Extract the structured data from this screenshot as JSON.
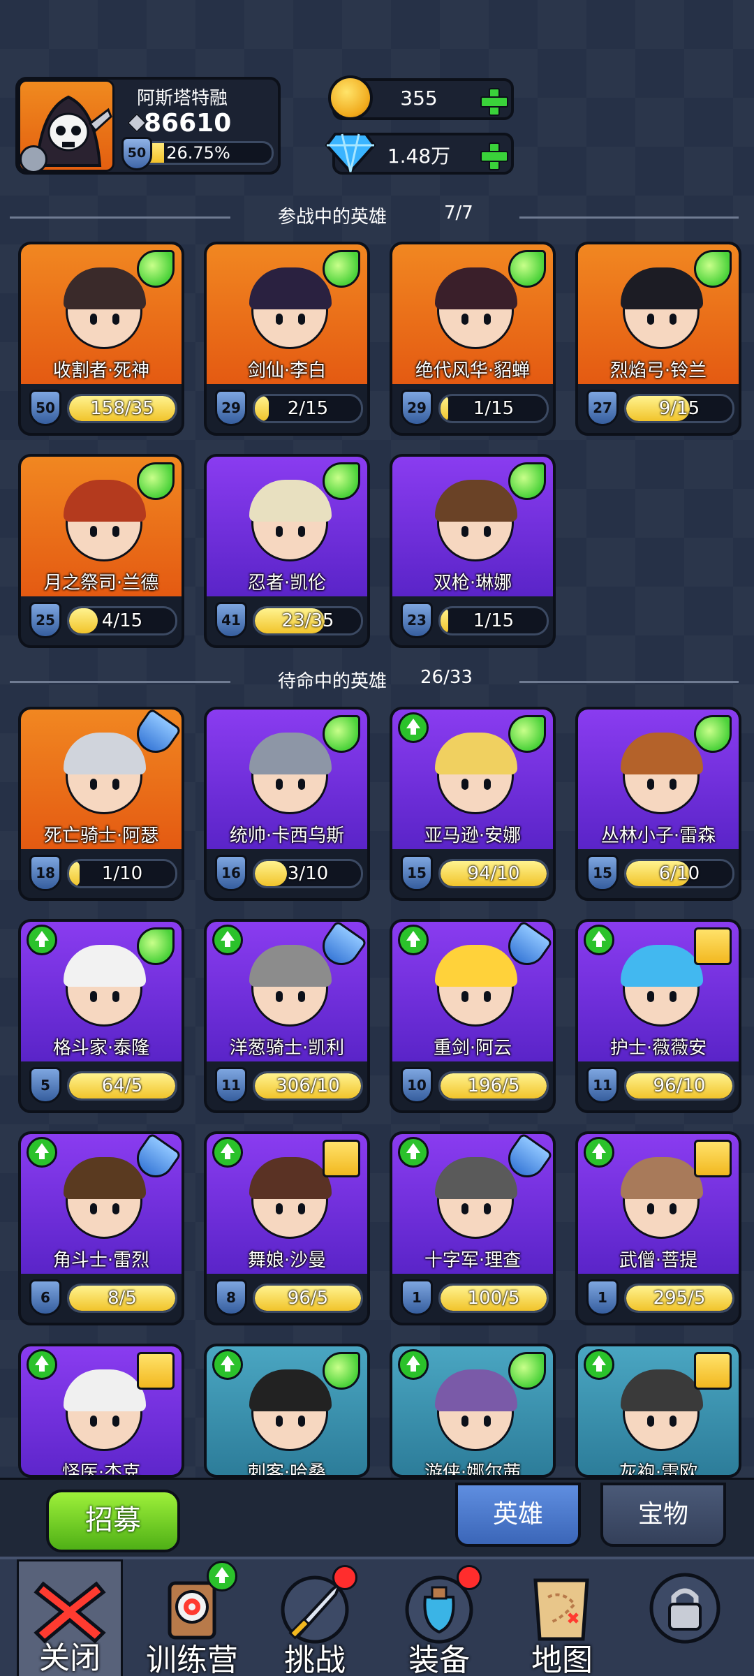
{
  "profile": {
    "name": "阿斯塔特融",
    "power": "86610",
    "level": "50",
    "exp_pct": "26.75%",
    "exp_fraction": 0.2675
  },
  "currency": {
    "gold": "355",
    "gems": "1.48万"
  },
  "active_section": {
    "title": "参战中的英雄",
    "count": "7/7"
  },
  "standby_section": {
    "title": "待命中的英雄",
    "count": "26/33"
  },
  "active_heroes": [
    {
      "name": "收割者·死神",
      "level": "50",
      "progress": "158/35",
      "fill": 1.0,
      "bg": "orange",
      "badge": "wing-icon",
      "upgrade": false,
      "hair": "#3a2a2a"
    },
    {
      "name": "剑仙·李白",
      "level": "29",
      "progress": "2/15",
      "fill": 0.13,
      "bg": "orange",
      "badge": "wing-icon",
      "upgrade": false,
      "hair": "#2a2140"
    },
    {
      "name": "绝代风华·貂蝉",
      "level": "29",
      "progress": "1/15",
      "fill": 0.07,
      "bg": "orange",
      "badge": "wing-icon",
      "upgrade": false,
      "hair": "#3a1f2a"
    },
    {
      "name": "烈焰弓·铃兰",
      "level": "27",
      "progress": "9/15",
      "fill": 0.6,
      "bg": "orange",
      "badge": "wing-icon",
      "upgrade": false,
      "hair": "#1c1c24"
    },
    {
      "name": "月之祭司·兰德",
      "level": "25",
      "progress": "4/15",
      "fill": 0.27,
      "bg": "orange",
      "badge": "wing-icon",
      "upgrade": false,
      "hair": "#b43a1e"
    },
    {
      "name": "忍者·凯伦",
      "level": "41",
      "progress": "23/35",
      "fill": 0.66,
      "bg": "purple",
      "badge": "wing-icon",
      "upgrade": false,
      "hair": "#e8e0c0"
    },
    {
      "name": "双枪·琳娜",
      "level": "23",
      "progress": "1/15",
      "fill": 0.07,
      "bg": "purple",
      "badge": "wing-icon",
      "upgrade": false,
      "hair": "#6a4226"
    }
  ],
  "standby_heroes": [
    {
      "name": "死亡骑士·阿瑟",
      "level": "18",
      "progress": "1/10",
      "fill": 0.1,
      "bg": "orange",
      "badge": "potion-icon",
      "upgrade": false,
      "hair": "#d0d4dc"
    },
    {
      "name": "统帅·卡西乌斯",
      "level": "16",
      "progress": "3/10",
      "fill": 0.3,
      "bg": "purple",
      "badge": "wing-icon",
      "upgrade": false,
      "hair": "#8d96a6"
    },
    {
      "name": "亚马逊·安娜",
      "level": "15",
      "progress": "94/10",
      "fill": 1.0,
      "bg": "purple",
      "badge": "wing-icon",
      "upgrade": true,
      "hair": "#f0d060"
    },
    {
      "name": "丛林小子·雷森",
      "level": "15",
      "progress": "6/10",
      "fill": 0.6,
      "bg": "purple",
      "badge": "wing-icon",
      "upgrade": false,
      "hair": "#b4622a"
    },
    {
      "name": "格斗家·泰隆",
      "level": "5",
      "progress": "64/5",
      "fill": 1.0,
      "bg": "purple",
      "badge": "wing-icon",
      "upgrade": true,
      "hair": "#f2f2f2"
    },
    {
      "name": "洋葱骑士·凯利",
      "level": "11",
      "progress": "306/10",
      "fill": 1.0,
      "bg": "purple",
      "badge": "potion-icon",
      "upgrade": true,
      "hair": "#8c8c8c"
    },
    {
      "name": "重剑·阿云",
      "level": "10",
      "progress": "196/5",
      "fill": 1.0,
      "bg": "purple",
      "badge": "potion-icon",
      "upgrade": true,
      "hair": "#ffd23a"
    },
    {
      "name": "护士·薇薇安",
      "level": "11",
      "progress": "96/10",
      "fill": 1.0,
      "bg": "purple",
      "badge": "book-icon",
      "upgrade": true,
      "hair": "#42b8f0"
    },
    {
      "name": "角斗士·雷烈",
      "level": "6",
      "progress": "8/5",
      "fill": 1.0,
      "bg": "purple",
      "badge": "potion-icon",
      "upgrade": true,
      "hair": "#5a3a20"
    },
    {
      "name": "舞娘·沙曼",
      "level": "8",
      "progress": "96/5",
      "fill": 1.0,
      "bg": "purple",
      "badge": "book-icon",
      "upgrade": true,
      "hair": "#5a3224"
    },
    {
      "name": "十字军·理查",
      "level": "1",
      "progress": "100/5",
      "fill": 1.0,
      "bg": "purple",
      "badge": "potion-icon",
      "upgrade": true,
      "hair": "#5a5a5a"
    },
    {
      "name": "武僧·菩提",
      "level": "1",
      "progress": "295/5",
      "fill": 1.0,
      "bg": "purple",
      "badge": "book-icon",
      "upgrade": true,
      "hair": "#a87a5a"
    },
    {
      "name": "怪医·杰克",
      "level": "",
      "progress": "",
      "fill": 0,
      "bg": "purple",
      "badge": "book-icon",
      "upgrade": true,
      "hair": "#f0f0f0"
    },
    {
      "name": "刺客·哈桑",
      "level": "",
      "progress": "",
      "fill": 0,
      "bg": "blue",
      "badge": "wing-icon",
      "upgrade": true,
      "hair": "#222222"
    },
    {
      "name": "游侠·娜尔茜",
      "level": "",
      "progress": "",
      "fill": 0,
      "bg": "blue",
      "badge": "wing-icon",
      "upgrade": true,
      "hair": "#7a5aa8"
    },
    {
      "name": "灰袍·雷欧",
      "level": "",
      "progress": "",
      "fill": 0,
      "bg": "blue",
      "badge": "book-icon",
      "upgrade": true,
      "hair": "#3a3a3a"
    }
  ],
  "bottom": {
    "recruit_label": "招募",
    "tabs": [
      {
        "label": "英雄",
        "active": true
      },
      {
        "label": "宝物",
        "active": false
      }
    ]
  },
  "nav": [
    {
      "label": "关闭",
      "icon": "close-icon"
    },
    {
      "label": "训练营",
      "icon": "training-camp-icon",
      "upgrade": true
    },
    {
      "label": "挑战",
      "icon": "challenge-sword-icon",
      "dot": true
    },
    {
      "label": "装备",
      "icon": "equipment-potion-icon",
      "dot": true
    },
    {
      "label": "地图",
      "icon": "map-icon"
    },
    {
      "label": "",
      "icon": "locked-icon"
    }
  ]
}
